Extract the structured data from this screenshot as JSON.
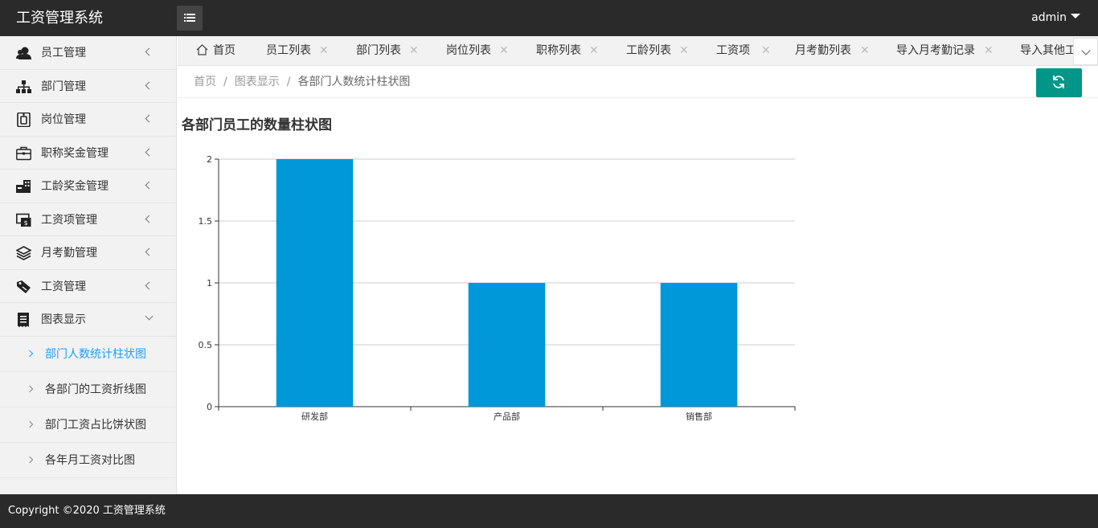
{
  "header": {
    "app_title": "工资管理系统",
    "user": "admin"
  },
  "sidebar": {
    "items": [
      {
        "label": "员工管理",
        "icon": "users-icon"
      },
      {
        "label": "部门管理",
        "icon": "org-chart-icon"
      },
      {
        "label": "岗位管理",
        "icon": "badge-icon"
      },
      {
        "label": "职称奖金管理",
        "icon": "briefcase-icon"
      },
      {
        "label": "工龄奖金管理",
        "icon": "building-icon"
      },
      {
        "label": "工资项管理",
        "icon": "salary-slip-icon"
      },
      {
        "label": "月考勤管理",
        "icon": "layers-icon"
      },
      {
        "label": "工资管理",
        "icon": "tag-icon"
      },
      {
        "label": "图表显示",
        "icon": "receipt-icon"
      }
    ],
    "sub_items": [
      {
        "label": "部门人数统计柱状图",
        "active": true
      },
      {
        "label": "各部门的工资折线图",
        "active": false
      },
      {
        "label": "部门工资占比饼状图",
        "active": false
      },
      {
        "label": "各年月工资对比图",
        "active": false
      }
    ]
  },
  "tabs": [
    {
      "label": "首页",
      "closable": false
    },
    {
      "label": "员工列表",
      "closable": true
    },
    {
      "label": "部门列表",
      "closable": true
    },
    {
      "label": "岗位列表",
      "closable": true
    },
    {
      "label": "职称列表",
      "closable": true
    },
    {
      "label": "工龄列表",
      "closable": true
    },
    {
      "label": "工资项",
      "closable": true
    },
    {
      "label": "月考勤列表",
      "closable": true
    },
    {
      "label": "导入月考勤记录",
      "closable": true
    },
    {
      "label": "导入其他工",
      "closable": false
    }
  ],
  "breadcrumb": {
    "items": [
      "首页",
      "图表显示",
      "各部门人数统计柱状图"
    ],
    "separator": "/"
  },
  "page": {
    "title": "各部门员工的数量柱状图"
  },
  "chart_data": {
    "type": "bar",
    "title": "各部门员工的数量柱状图",
    "categories": [
      "研发部",
      "产品部",
      "销售部"
    ],
    "values": [
      2,
      1,
      1
    ],
    "xlabel": "",
    "ylabel": "",
    "ylim": [
      0,
      2
    ],
    "yticks": [
      "0",
      "0.5",
      "1",
      "1.5",
      "2"
    ],
    "bar_color": "#0098d9",
    "grid": true
  },
  "footer": {
    "copyright": "Copyright ©2020 工资管理系统"
  },
  "colors": {
    "header_bg": "#2a2a2a",
    "accent": "#1e9fff",
    "refresh_button": "#009688"
  }
}
